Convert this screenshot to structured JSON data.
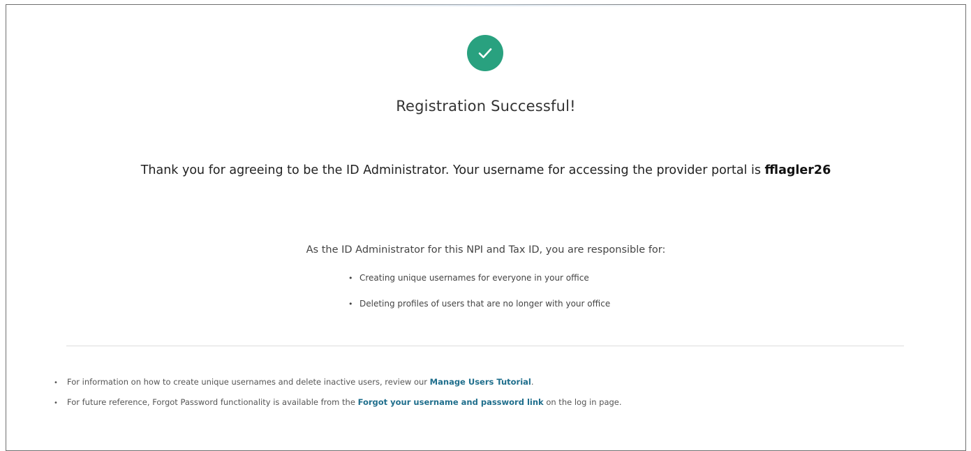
{
  "colors": {
    "success_green": "#29a17f",
    "link_blue": "#1f6e8c"
  },
  "success_icon": "checkmark-icon",
  "heading": "Registration Successful!",
  "thanks": {
    "text": "Thank you for agreeing to be the ID Administrator. Your username for accessing the provider portal is",
    "username": "fflagler26"
  },
  "responsibilities": {
    "heading": "As the ID Administrator for this NPI and Tax ID, you are responsible for:",
    "items": [
      "Creating unique usernames for everyone in your office",
      "Deleting profiles of users that are no longer with your office"
    ]
  },
  "info": {
    "item1": {
      "before": "For information on how to create unique usernames and delete inactive users, review our",
      "link": "Manage Users Tutorial",
      "after": "."
    },
    "item2": {
      "before": "For future reference, Forgot Password functionality is available from the",
      "link": "Forgot your username and password link",
      "after": "on the log in page."
    }
  }
}
